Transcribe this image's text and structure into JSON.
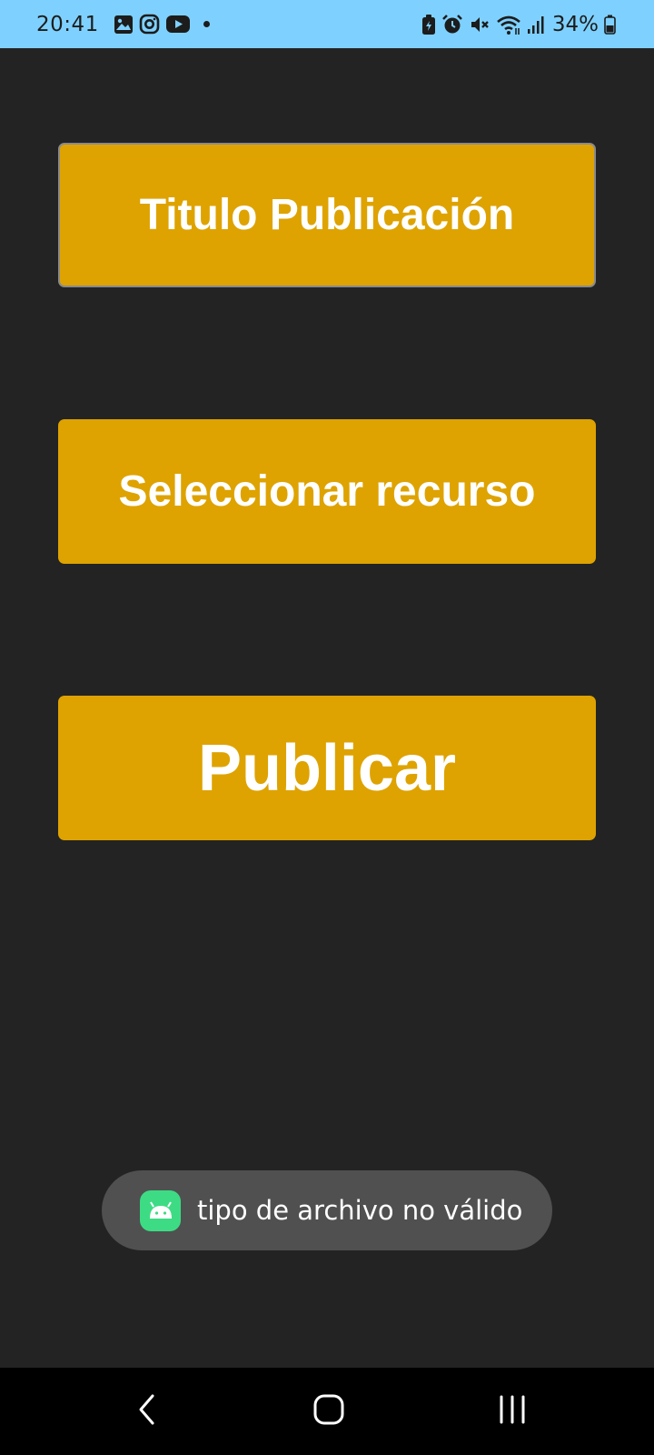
{
  "status_bar": {
    "time": "20:41",
    "notification_icons": [
      "gallery-icon",
      "instagram-icon",
      "youtube-icon"
    ],
    "system_icons": [
      "battery-saver-icon",
      "alarm-icon",
      "mute-icon",
      "wifi-icon",
      "signal-icon"
    ],
    "battery": "34%"
  },
  "form": {
    "title_label": "Titulo Publicación",
    "select_resource_label": "Seleccionar recurso",
    "publish_label": "Publicar"
  },
  "toast": {
    "icon": "android-icon",
    "message": "tipo de archivo no válido"
  },
  "nav_bar": {
    "buttons": [
      "back-icon",
      "home-icon",
      "recents-icon"
    ]
  },
  "colors": {
    "status_bar_bg": "#7ed1ff",
    "app_bg": "#232323",
    "button_bg": "#dea300",
    "button_text": "#ffffff",
    "toast_bg": "#505050",
    "nav_bar_bg": "#000000"
  }
}
